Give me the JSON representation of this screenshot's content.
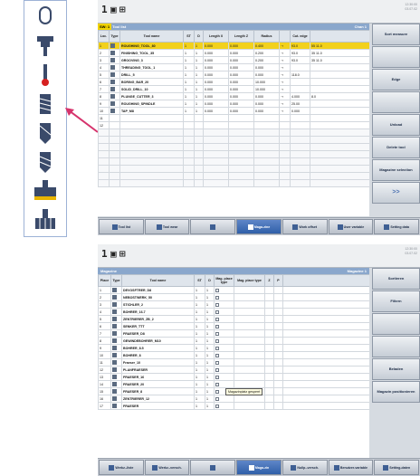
{
  "tool_icons": [
    {
      "name": "shank-end-mill-icon"
    },
    {
      "name": "drill-chuck-icon"
    },
    {
      "name": "probe-icon"
    },
    {
      "name": "thread-mill-icon"
    },
    {
      "name": "twist-drill-icon"
    },
    {
      "name": "spiral-drill-icon"
    },
    {
      "name": "face-mill-icon"
    },
    {
      "name": "multi-tooth-tool-icon"
    }
  ],
  "colors": {
    "accent": "#8aa7cc",
    "selection": "#f2d11c",
    "arrow": "#d6336c"
  },
  "screen1": {
    "clock": [
      "12:30:00",
      "03.07.02"
    ],
    "title_highlight": "SW: 1",
    "title": "Tool list",
    "title_right": "Chan 1",
    "columns": [
      "Loc.",
      "Type",
      "Tool name",
      "ST",
      "D",
      "Length X",
      "Length Z",
      "Radius",
      "",
      "Cut. edge",
      ""
    ],
    "rows": [
      {
        "loc": "1",
        "name": "ROUGHING_TOOL_80",
        "st": "1",
        "d": "1",
        "lx": "0.000",
        "lz": "0.000",
        "r": "0.400",
        "a": "93.0",
        "b": "55",
        "c": "11.0",
        "sel": true
      },
      {
        "loc": "2",
        "name": "FINISHING_TOOL_35",
        "st": "1",
        "d": "1",
        "lx": "0.000",
        "lz": "0.000",
        "r": "0.200",
        "a": "93.0",
        "b": "35",
        "c": "11.0"
      },
      {
        "loc": "3",
        "name": "GROOVING_3",
        "st": "1",
        "d": "1",
        "lx": "0.000",
        "lz": "0.000",
        "r": "0.200",
        "a": "93.0",
        "b": "35",
        "c": "11.0"
      },
      {
        "loc": "4",
        "name": "THREADING_TOOL_1",
        "st": "1",
        "d": "1",
        "lx": "0.000",
        "lz": "0.000",
        "r": "0.000",
        "a": "",
        "b": "",
        "c": ""
      },
      {
        "loc": "5",
        "name": "DRILL_5",
        "st": "1",
        "d": "1",
        "lx": "0.000",
        "lz": "0.000",
        "r": "0.000",
        "a": "118.0",
        "b": "",
        "c": ""
      },
      {
        "loc": "6",
        "name": "BORING_BAR_20",
        "st": "1",
        "d": "1",
        "lx": "0.000",
        "lz": "0.000",
        "r": "10.000",
        "a": "",
        "b": "",
        "c": ""
      },
      {
        "loc": "7",
        "name": "SOLID_DRILL_10",
        "st": "1",
        "d": "1",
        "lx": "0.000",
        "lz": "0.000",
        "r": "10.000",
        "a": "",
        "b": "",
        "c": ""
      },
      {
        "loc": "8",
        "name": "PLUNGE_CUTTER_3",
        "st": "1",
        "d": "1",
        "lx": "0.000",
        "lz": "0.000",
        "r": "0.000",
        "a": "4.000",
        "b": "8.0",
        "c": ""
      },
      {
        "loc": "9",
        "name": "ROUGHING_SPINDLE",
        "st": "1",
        "d": "1",
        "lx": "0.000",
        "lz": "0.000",
        "r": "0.000",
        "a": "25.00",
        "b": "",
        "c": ""
      },
      {
        "loc": "10",
        "name": "TAP_M8",
        "st": "1",
        "d": "1",
        "lx": "0.000",
        "lz": "0.000",
        "r": "0.000",
        "a": "0.000",
        "b": "",
        "c": ""
      },
      {
        "loc": "11",
        "name": "",
        "st": "",
        "d": "",
        "lx": "",
        "lz": "",
        "r": "",
        "a": "",
        "b": "",
        "c": ""
      },
      {
        "loc": "12",
        "name": "",
        "st": "",
        "d": "",
        "lx": "",
        "lz": "",
        "r": "",
        "a": "",
        "b": "",
        "c": ""
      }
    ],
    "softkeys": [
      "Sort measure",
      "",
      "Edge",
      "",
      "Unload",
      "Delete tool",
      "Magazine selection",
      ">>"
    ],
    "bottom": [
      "Tool list",
      "Tool wear",
      "",
      "Maga-zine",
      "Work offset",
      "User variable",
      "Setting data"
    ]
  },
  "screen2": {
    "clock": [
      "12:30:00",
      "03.07.02"
    ],
    "title": "Magazine",
    "title_right": "Magazine 1",
    "columns": [
      "Place",
      "Type",
      "Tool name",
      "ST",
      "D",
      "Mag. place type",
      "Mag. place type",
      "Z",
      "P"
    ],
    "rows": [
      {
        "loc": "1",
        "name": "DEVOSFTRER_D8"
      },
      {
        "loc": "2",
        "name": "NEBOSTWERK_50"
      },
      {
        "loc": "3",
        "name": "STICHLER_2"
      },
      {
        "loc": "4",
        "name": "BOHRER_16.7"
      },
      {
        "loc": "5",
        "name": "ZENTRIERER_ZB_2"
      },
      {
        "loc": "6",
        "name": "SENKER_TTT"
      },
      {
        "loc": "7",
        "name": "FRAESER_D8"
      },
      {
        "loc": "8",
        "name": "GEWINDEBOHRER_M10"
      },
      {
        "loc": "9",
        "name": "BOHRER_8.5"
      },
      {
        "loc": "10",
        "name": "BOHRER_8"
      },
      {
        "loc": "11",
        "name": "Fraeser_10"
      },
      {
        "loc": "12",
        "name": "PLANFRAESER"
      },
      {
        "loc": "13",
        "name": "FRAESER_16"
      },
      {
        "loc": "14",
        "name": "FRAESER_20"
      },
      {
        "loc": "15",
        "name": "FRAESER_8"
      },
      {
        "loc": "16",
        "name": "ZENTRIERER_12"
      },
      {
        "loc": "17",
        "name": "FRAESER"
      }
    ],
    "tooltip": "Magazinplatz gesperrt",
    "softkeys": [
      "Sortieren",
      "Filtern",
      "",
      "",
      "Beladen",
      "Magazin positionieren"
    ],
    "bottom": [
      "Werkz.-liste",
      "Werkz.-versch.",
      "",
      "Maga-zin",
      "Nullp.-versch.",
      "Benutzer-variable",
      "Setting-daten"
    ]
  }
}
